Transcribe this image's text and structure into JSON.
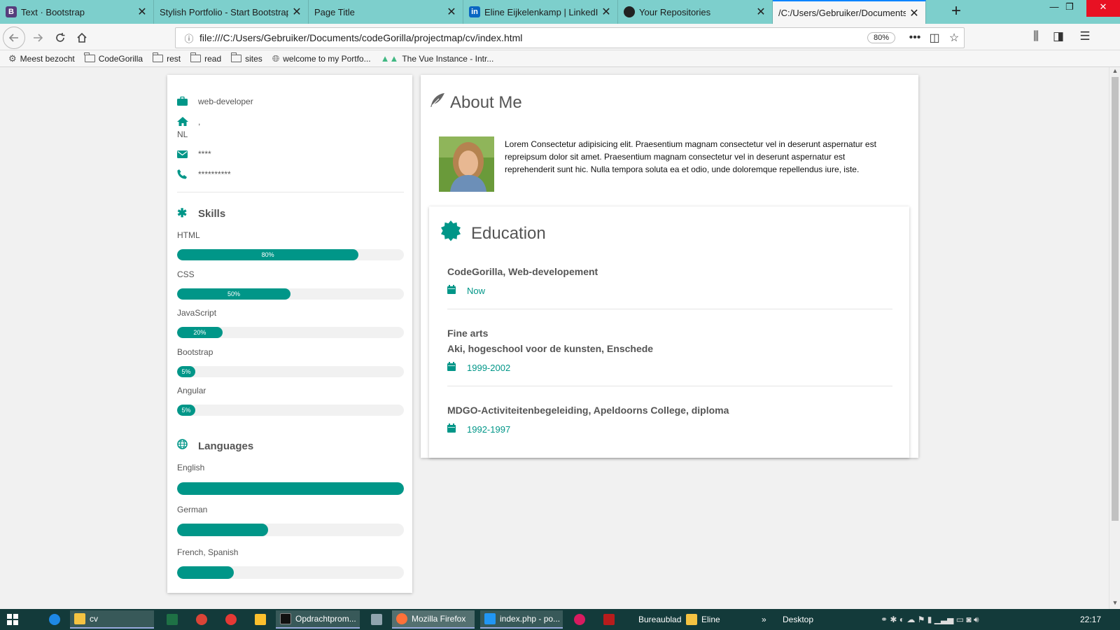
{
  "browser": {
    "tabs": [
      {
        "title": "Text · Bootstrap",
        "icon": "B",
        "icon_color": "#563d7c"
      },
      {
        "title": "Stylish Portfolio - Start Bootstrap Te",
        "icon": "",
        "icon_color": ""
      },
      {
        "title": "Page Title",
        "icon": "",
        "icon_color": ""
      },
      {
        "title": "Eline Eijkelenkamp | LinkedIn",
        "icon": "in",
        "icon_color": "#0a66c2"
      },
      {
        "title": "Your Repositories",
        "icon": "",
        "icon_color": "#222"
      },
      {
        "title": "/C:/Users/Gebruiker/Documents/c",
        "icon": "",
        "icon_color": ""
      }
    ],
    "url": "file:///C:/Users/Gebruiker/Documents/codeGorilla/projectmap/cv/index.html",
    "zoom": "80%",
    "bookmarks": [
      {
        "label": "Meest bezocht",
        "icon": "gear-icon"
      },
      {
        "label": "CodeGorilla",
        "icon": "folder-icon"
      },
      {
        "label": "rest",
        "icon": "folder-icon"
      },
      {
        "label": "read",
        "icon": "folder-icon"
      },
      {
        "label": "sites",
        "icon": "folder-icon"
      },
      {
        "label": "welcome to my Portfo...",
        "icon": "globe-icon"
      },
      {
        "label": "The Vue Instance - Intr...",
        "icon": "vue-icon"
      }
    ]
  },
  "sidebar": {
    "job": "web-developer",
    "location_line1": ",",
    "location_line2": "NL",
    "email": "****",
    "phone": "**********",
    "skills_title": "Skills",
    "skills": [
      {
        "name": "HTML",
        "percent": 80,
        "label": "80%"
      },
      {
        "name": "CSS",
        "percent": 50,
        "label": "50%"
      },
      {
        "name": "JavaScript",
        "percent": 20,
        "label": "20%"
      },
      {
        "name": "Bootstrap",
        "percent": 5,
        "label": "5%"
      },
      {
        "name": "Angular",
        "percent": 5,
        "label": "5%"
      }
    ],
    "languages_title": "Languages",
    "languages": [
      {
        "name": "English",
        "percent": 100
      },
      {
        "name": "German",
        "percent": 40
      },
      {
        "name": "French, Spanish",
        "percent": 25
      }
    ]
  },
  "about": {
    "title": "About Me",
    "text": "Lorem Consectetur adipisicing elit. Praesentium magnam consectetur vel in deserunt aspernatur est repreipsum dolor sit amet. Praesentium magnam consectetur vel in deserunt aspernatur est reprehenderit sunt hic. Nulla tempora soluta ea et odio, unde doloremque repellendus iure, iste."
  },
  "education": {
    "title": "Education",
    "items": [
      {
        "line1": "CodeGorilla, Web-developement",
        "line2": "",
        "date": "Now"
      },
      {
        "line1": "Fine arts",
        "line2": "Aki, hogeschool voor de kunsten, Enschede",
        "date": "1999-2002"
      },
      {
        "line1": "MDGO-Activiteitenbegeleiding, Apeldoorns College, diploma",
        "line2": "",
        "date": "1992-1997"
      }
    ]
  },
  "taskbar": {
    "items": [
      "cv",
      "Opdrachtprom...",
      "Mozilla Firefox",
      "index.php - po...",
      "Bureaublad",
      "Eline",
      "Desktop"
    ],
    "clock": "22:17"
  },
  "colors": {
    "accent": "#009688",
    "tabbar": "#7dcfcc",
    "taskbar": "#133a3a"
  }
}
